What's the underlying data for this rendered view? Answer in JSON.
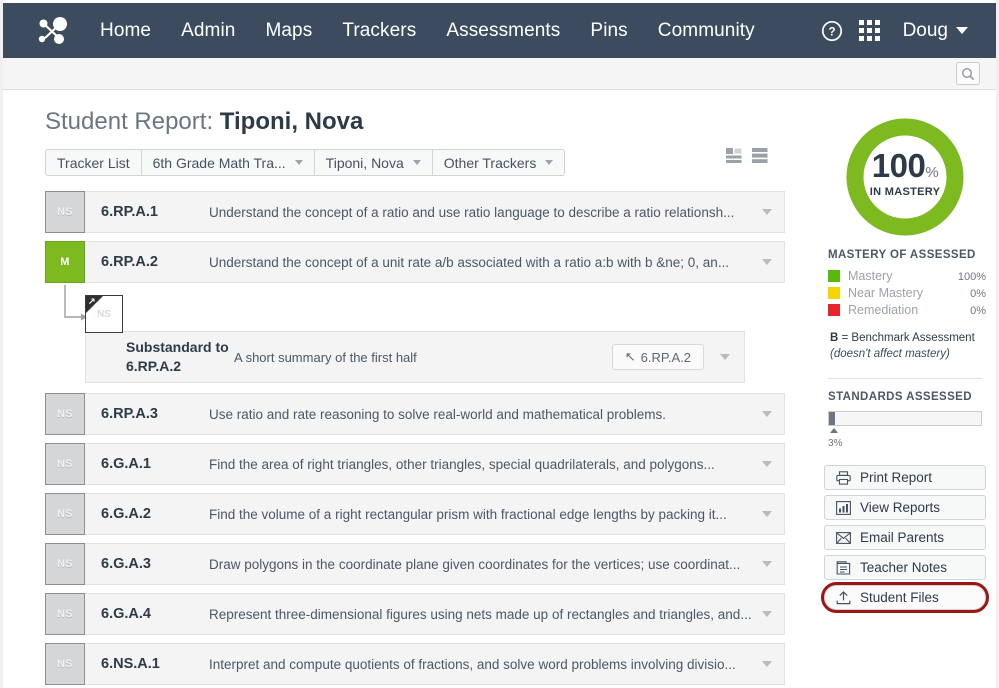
{
  "nav": {
    "logo_icon": "network-nodes-logo",
    "links": [
      "Home",
      "Admin",
      "Maps",
      "Trackers",
      "Assessments",
      "Pins",
      "Community"
    ],
    "help_icon": "help-circle-icon",
    "apps_icon": "grid-apps-icon",
    "user_name": "Doug",
    "user_caret_icon": "chevron-down-icon"
  },
  "subbar": {
    "search_icon": "search-icon"
  },
  "page": {
    "title_prefix": "Student Report: ",
    "title_student": "Tiponi, Nova"
  },
  "filters": [
    {
      "label": "Tracker List",
      "has_caret": false
    },
    {
      "label": "6th Grade Math Tra...",
      "has_caret": true
    },
    {
      "label": "Tiponi, Nova",
      "has_caret": true
    },
    {
      "label": "Other Trackers",
      "has_caret": true
    }
  ],
  "view_toggles": [
    {
      "name": "card-view-icon"
    },
    {
      "name": "list-view-icon"
    }
  ],
  "standards": [
    {
      "badge": "NS",
      "status": "not-started",
      "code": "6.RP.A.1",
      "description": "Understand the concept of a ratio and use ratio language to describe a ratio relationsh..."
    },
    {
      "badge": "M",
      "status": "mastery",
      "code": "6.RP.A.2",
      "description": "Understand the concept of a unit rate a/b associated with a ratio a:b with b &ne; 0, an..."
    },
    {
      "badge": "NS",
      "status": "not-started",
      "code": "6.RP.A.3",
      "description": "Use ratio and rate reasoning to solve real-world and mathematical problems."
    },
    {
      "badge": "NS",
      "status": "not-started",
      "code": "6.G.A.1",
      "description": "Find the area of right triangles, other triangles, special quadrilaterals, and polygons..."
    },
    {
      "badge": "NS",
      "status": "not-started",
      "code": "6.G.A.2",
      "description": "Find the volume of a right rectangular prism with fractional edge lengths by packing it..."
    },
    {
      "badge": "NS",
      "status": "not-started",
      "code": "6.G.A.3",
      "description": "Draw polygons in the coordinate plane given coordinates for the vertices; use coordinat..."
    },
    {
      "badge": "NS",
      "status": "not-started",
      "code": "6.G.A.4",
      "description": "Represent three-dimensional figures using nets made up of rectangles and triangles, and..."
    },
    {
      "badge": "NS",
      "status": "not-started",
      "code": "6.NS.A.1",
      "description": "Interpret and compute quotients of fractions, and solve word problems involving divisio..."
    }
  ],
  "substandard": {
    "badge": "NS",
    "corner_icon": "substandard-corner-arrow-icon",
    "label": "Substandard to 6.RP.A.2",
    "summary": "A short summary of the first half",
    "parent_pill_icon": "arrow-up-left-icon",
    "parent_pill_label": "6.RP.A.2",
    "caret_icon": "chevron-down-icon"
  },
  "sidebar": {
    "donut": {
      "value": "100",
      "percent_sign": "%",
      "caption": "IN MASTERY",
      "color": "#7cba1f",
      "fill_percent": 100
    },
    "mastery_heading": "MASTERY OF ASSESSED",
    "legend": [
      {
        "name": "Mastery",
        "value": "100",
        "unit": "%",
        "color": "#5ab80c"
      },
      {
        "name": "Near Mastery",
        "value": "0",
        "unit": "%",
        "color": "#f5d400"
      },
      {
        "name": "Remediation",
        "value": "0",
        "unit": "%",
        "color": "#e8252a"
      }
    ],
    "benchmark_note_bold": "B",
    "benchmark_note_text": " = Benchmark Assessment",
    "benchmark_note_italic": "(doesn't affect mastery)",
    "standards_heading": "STANDARDS ASSESSED",
    "standards_percent_value": "3",
    "standards_percent_unit": "%",
    "standards_fill": 3,
    "actions": [
      {
        "label": "Print Report",
        "icon": "printer-icon",
        "highlight": false
      },
      {
        "label": "View Reports",
        "icon": "bar-chart-icon",
        "highlight": false
      },
      {
        "label": "Email Parents",
        "icon": "envelope-icon",
        "highlight": false
      },
      {
        "label": "Teacher Notes",
        "icon": "notes-clipboard-icon",
        "highlight": false
      },
      {
        "label": "Student Files",
        "icon": "upload-icon",
        "highlight": true
      }
    ],
    "highlight_color": "#9c1616"
  }
}
